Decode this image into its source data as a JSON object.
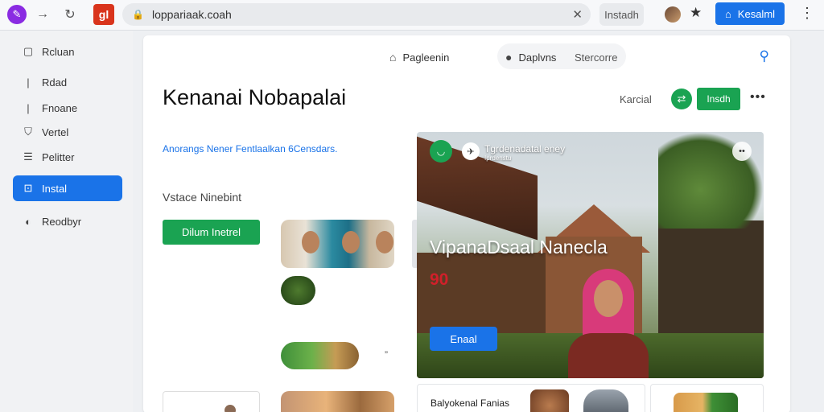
{
  "browser": {
    "url": "loppariaak.coah",
    "install_label": "Instadh",
    "login_label": "Kesalml",
    "ext_logo_text": "gl"
  },
  "sidebar": {
    "items": [
      {
        "label": "Rcluan",
        "icon": "square-icon"
      },
      {
        "label": "Rdad",
        "icon": "bar-icon"
      },
      {
        "label": "Fnoane",
        "icon": "bar-icon"
      },
      {
        "label": "Vertel",
        "icon": "shield-icon"
      },
      {
        "label": "Pelitter",
        "icon": "list-icon"
      },
      {
        "label": "Instal",
        "icon": "install-icon",
        "active": true
      },
      {
        "label": "Reodbyr",
        "icon": "leaf-icon"
      }
    ]
  },
  "main": {
    "nav": {
      "home_label": "Pagleenin",
      "chat_label": "Daplvns",
      "tab_label": "Stercorre"
    },
    "title": "Kenanai Nobapalai",
    "kanal_label": "Karcial",
    "install_btn": "Insdh",
    "link_text": "Anorangs Nener Fentlaalkan 6Censdars.",
    "section_heading": "Vstace Ninebint",
    "green_btn": "Dilum Inetrel",
    "hero": {
      "channel": "Tgrdenadatal eney",
      "sub": "Iprdenstu",
      "title": "VipanaDsaal Nanecla",
      "badge": "90",
      "button": "Enaal"
    },
    "bottom_card_label": "Balyokenal Fanias"
  },
  "colors": {
    "accent_blue": "#1a73e8",
    "accent_green": "#1aa352",
    "brand_purple": "#8a2be2",
    "hijab_pink": "#d83a7a"
  }
}
